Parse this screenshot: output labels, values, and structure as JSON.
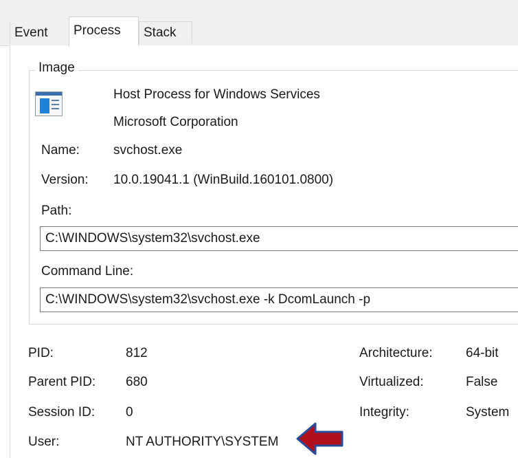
{
  "tabs": [
    {
      "label": "Event"
    },
    {
      "label": "Process"
    },
    {
      "label": "Stack"
    }
  ],
  "active_tab": "Process",
  "image": {
    "group_title": "Image",
    "description": "Host Process for Windows Services",
    "company": "Microsoft Corporation",
    "name_label": "Name:",
    "name_value": "svchost.exe",
    "version_label": "Version:",
    "version_value": "10.0.19041.1 (WinBuild.160101.0800)",
    "path_label": "Path:",
    "path_value": "C:\\WINDOWS\\system32\\svchost.exe",
    "cmdline_label": "Command Line:",
    "cmdline_value": "C:\\WINDOWS\\system32\\svchost.exe -k DcomLaunch -p"
  },
  "details": {
    "pid_label": "PID:",
    "pid_value": "812",
    "parent_pid_label": "Parent PID:",
    "parent_pid_value": "680",
    "session_id_label": "Session ID:",
    "session_id_value": "0",
    "user_label": "User:",
    "user_value": "NT AUTHORITY\\SYSTEM",
    "architecture_label": "Architecture:",
    "architecture_value": "64-bit",
    "virtualized_label": "Virtualized:",
    "virtualized_value": "False",
    "integrity_label": "Integrity:",
    "integrity_value": "System"
  },
  "colors": {
    "annotation_arrow": "#b0101c",
    "icon_accent": "#1d82d8"
  }
}
